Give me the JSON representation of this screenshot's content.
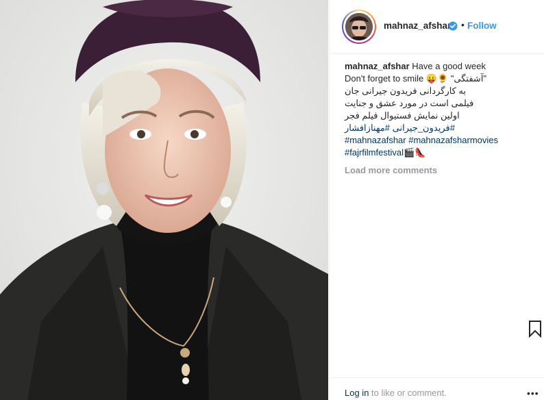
{
  "post": {
    "username": "mahnaz_afshar",
    "follow_label": "Follow",
    "separator": "•",
    "caption": {
      "line1": "Have a good week",
      "line2": "Don't forget to smile 😛🌻 \"آشفتگی\"",
      "line3": "به کارگردانی فریدون جیرانی جان",
      "line4": "فیلمی است در مورد عشق و جنایت",
      "line5": "اولین نمایش فستیوال فیلم فجر",
      "hashtags1": "#فریدون_جیرانی #مهنازافشار",
      "hashtags2": "#mahnazafshar #mahnazafsharmovies",
      "hashtags3": "#fajrfilmfestival🎬👠"
    },
    "load_more": "Load more comments"
  },
  "footer": {
    "login_link": "Log in",
    "login_text": " to like or comment.",
    "more": "•••"
  },
  "icons": {
    "verified": "verified-badge-icon",
    "bookmark": "bookmark-icon",
    "more": "more-options-icon"
  },
  "colors": {
    "link_blue": "#3897f0",
    "hashtag_blue": "#003569",
    "muted_grey": "#999999",
    "text": "#262626"
  }
}
